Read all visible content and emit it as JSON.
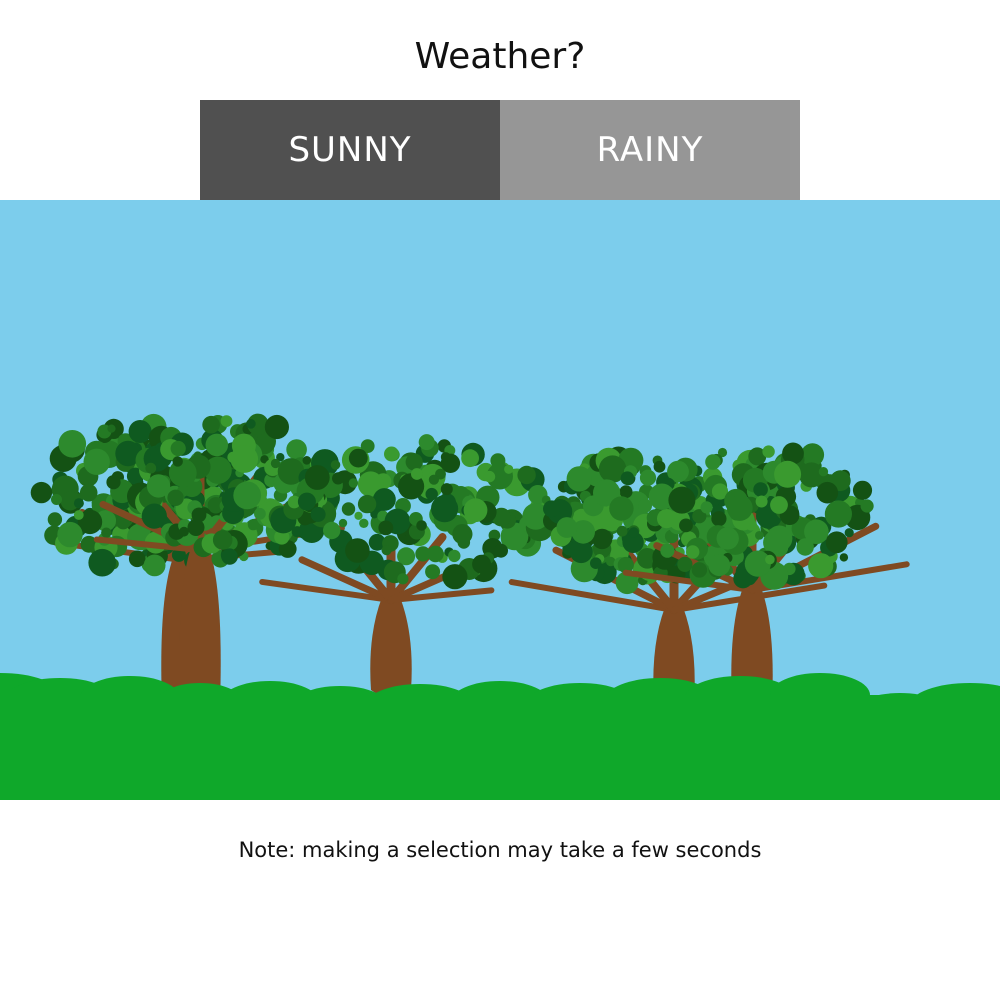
{
  "header": {
    "title": "Weather?"
  },
  "weather_toggle": {
    "options": [
      {
        "label": "SUNNY",
        "selected": true
      },
      {
        "label": "RAINY",
        "selected": false
      }
    ],
    "selected_color": "#505050",
    "unselected_color": "#969696"
  },
  "scene": {
    "sky_color": "#7ccdec",
    "ground_color": "#0fa82a",
    "trunk_color": "#7f4a22",
    "foliage_colors": [
      "#1e6b1e",
      "#2d8a2d",
      "#145214",
      "#3a9a2f",
      "#0f5a20",
      "#247a24"
    ],
    "trees": [
      "tree-1",
      "tree-2",
      "tree-3",
      "tree-4",
      "tree-5"
    ]
  },
  "footer": {
    "note": "Note: making a selection may take a few seconds"
  }
}
